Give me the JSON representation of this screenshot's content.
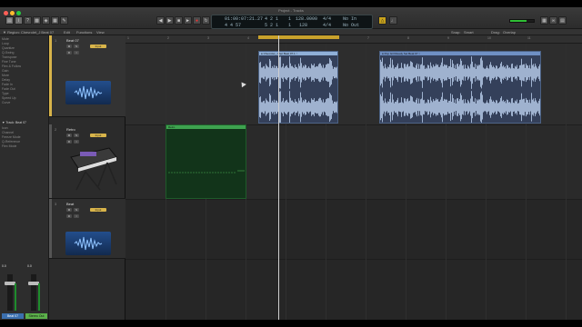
{
  "window": {
    "title": "Project - Tracks"
  },
  "control_bar": {
    "lcd": {
      "bar_pos_top": "01:00:07:21.27",
      "bar_pos_bottom": "4   4   57",
      "beats_top": "4  2  1",
      "beats_bottom": "5  2  1",
      "ticks_top": "1",
      "ticks_bottom": "1",
      "tempo_top": "128.0000",
      "tempo_bottom": "128",
      "sig_top": "4/4",
      "sig_bottom": "4/4",
      "in_top": "No In",
      "in_bottom": "No Out"
    },
    "master_level_fraction": 0.7
  },
  "sub_bar": {
    "region_label": "▼ Region: Chevrolet_J Beat 07",
    "edit": "Edit",
    "functions": "Functions",
    "view": "View",
    "snap_label": "Snap:",
    "snap_value": "Smart",
    "drag_label": "Drag:",
    "drag_value": "Overlap"
  },
  "inspector": {
    "rows": [
      "Mute",
      "Loop",
      "Quantize",
      "Q-Swing",
      "Transpose",
      "Fine Tune",
      "Flex & Follow",
      "Gain",
      "More",
      "Delay",
      "Fade In",
      "Fade Out",
      "Type",
      "Speed Up",
      "Curve"
    ],
    "track_header": "▼ Track: Beat 07",
    "track_rows": [
      "Icon",
      "Channel",
      "Freeze Mode",
      "Q-Reference",
      "Flex Mode"
    ],
    "channel_a_label": "Beat 07",
    "channel_b_label": "Stereo Out",
    "channel_a_value": "0.0",
    "channel_b_value": "0.0"
  },
  "tracks": [
    {
      "num": "1",
      "name": "Beat 07",
      "buttons": [
        "M",
        "S",
        "R",
        "I"
      ],
      "kind": "audio",
      "btn_label": "Input"
    },
    {
      "num": "2",
      "name": "Retro",
      "buttons": [
        "M",
        "S",
        "R",
        "I"
      ],
      "kind": "synth",
      "btn_label": "Input"
    },
    {
      "num": "3",
      "name": "Beat",
      "buttons": [
        "M",
        "S",
        "R",
        "I"
      ],
      "kind": "audio",
      "btn_label": "Input"
    }
  ],
  "ruler": {
    "marks": [
      "1",
      "2",
      "3",
      "4",
      "5",
      "6",
      "7",
      "8",
      "9",
      "10",
      "11"
    ]
  },
  "regions": {
    "audio_a": "● Chevrolet_J Set Beat 07.1 ○",
    "audio_b": "● Pop Girl Ready Set Beat 07 ○",
    "midi": "Retro"
  },
  "colors": {
    "accent_yellow": "#d8b44a",
    "audio_region": "#34405a",
    "midi_region": "#12341a",
    "record": "#e33"
  },
  "icons": [
    "rewind-icon",
    "forward-icon",
    "stop-icon",
    "play-icon",
    "record-icon",
    "cycle-icon",
    "metronome-icon",
    "synth-keyboard-icon",
    "waveform-icon"
  ]
}
